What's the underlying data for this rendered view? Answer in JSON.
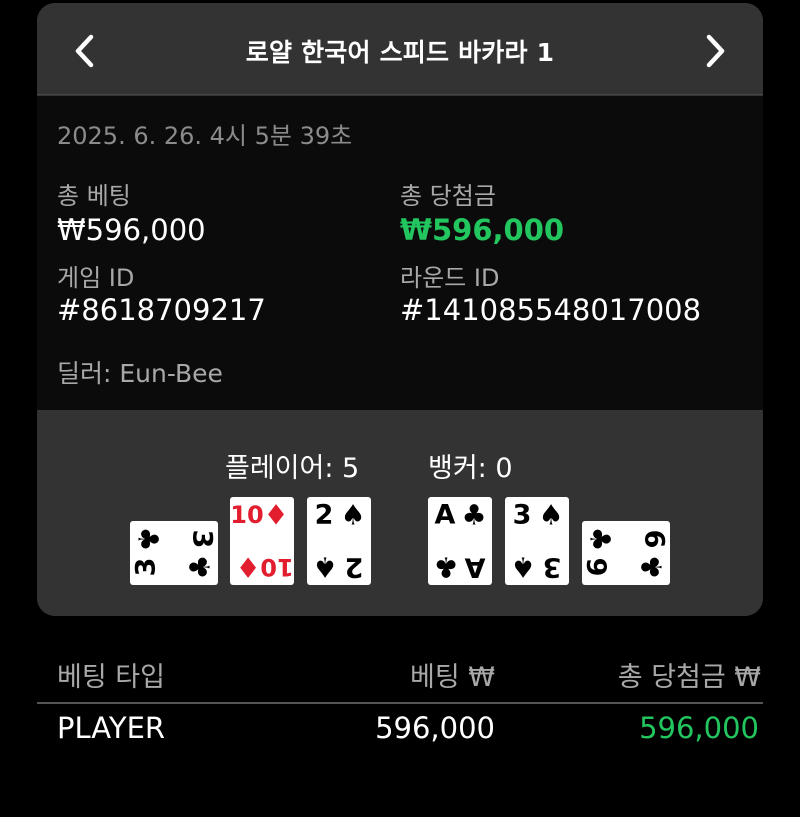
{
  "header": {
    "title": "로얄 한국어 스피드 바카라 1",
    "prev_icon": "chevron-left-icon",
    "next_icon": "chevron-right-icon"
  },
  "info": {
    "timestamp": "2025. 6. 26. 4시 5분 39초",
    "total_bet_label": "총 베팅",
    "total_bet_value": "₩596,000",
    "total_win_label": "총 당첨금",
    "total_win_value": "₩596,000",
    "game_id_label": "게임 ID",
    "game_id_value": "#8618709217",
    "round_id_label": "라운드 ID",
    "round_id_value": "#141085548017008",
    "dealer": "딜러: Eun-Bee"
  },
  "table": {
    "player_score": "플레이어: 5",
    "banker_score": "뱅커: 0",
    "player_cards": [
      {
        "rank": "3",
        "suit": "♣",
        "color": "#000000",
        "orientation": "sideways"
      },
      {
        "rank": "10",
        "suit": "♦",
        "color": "#e11d2e",
        "orientation": "upright"
      },
      {
        "rank": "2",
        "suit": "♠",
        "color": "#000000",
        "orientation": "upright"
      }
    ],
    "banker_cards": [
      {
        "rank": "A",
        "suit": "♣",
        "color": "#000000",
        "orientation": "upright"
      },
      {
        "rank": "3",
        "suit": "♠",
        "color": "#000000",
        "orientation": "upright"
      },
      {
        "rank": "6",
        "suit": "♣",
        "color": "#000000",
        "orientation": "sideways"
      }
    ]
  },
  "bets": {
    "headers": [
      "베팅 타입",
      "베팅 ₩",
      "총 당첨금 ₩"
    ],
    "rows": [
      {
        "type": "PLAYER",
        "bet": "596,000",
        "win": "596,000"
      }
    ]
  },
  "colors": {
    "win": "#22c55e",
    "panel": "#333333",
    "info_bg": "#0b0b0b"
  }
}
